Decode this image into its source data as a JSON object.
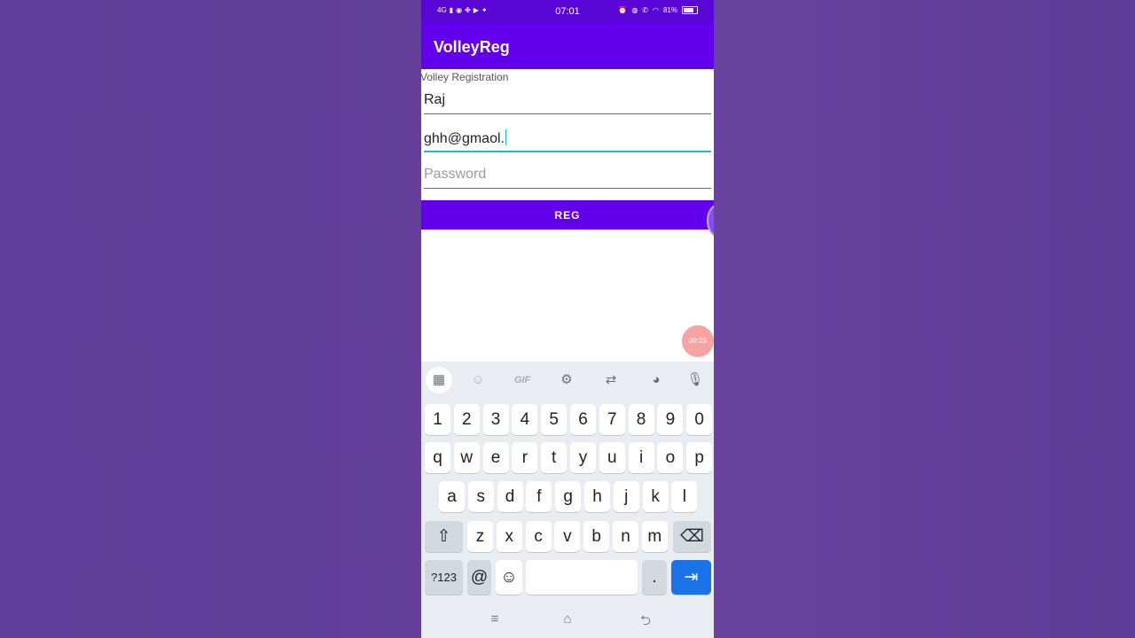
{
  "status_bar": {
    "left_icons": [
      "4G",
      "signal-icon",
      "whatsapp-icon",
      "app-icon",
      "youtube-icon",
      "twitter-icon"
    ],
    "network_label": "4G",
    "time": "07:01",
    "battery": "81%"
  },
  "app_bar": {
    "title": "VolleyReg"
  },
  "form": {
    "label": "Volley Registration",
    "name_value": "Raj",
    "email_value": "ghh@gmaol.",
    "password_placeholder": "Password",
    "reg_button": "REG"
  },
  "overlay": {
    "timer": "00:25"
  },
  "keyboard": {
    "toolbar": [
      "grid-icon",
      "sticker-icon",
      "GIF",
      "gear-icon",
      "translate-icon",
      "palette-icon",
      "mic-off-icon"
    ],
    "gif_label": "GIF",
    "row_numbers": [
      "1",
      "2",
      "3",
      "4",
      "5",
      "6",
      "7",
      "8",
      "9",
      "0"
    ],
    "row_q": [
      "q",
      "w",
      "e",
      "r",
      "t",
      "y",
      "u",
      "i",
      "o",
      "p"
    ],
    "row_a": [
      "a",
      "s",
      "d",
      "f",
      "g",
      "h",
      "j",
      "k",
      "l"
    ],
    "row_z": [
      "z",
      "x",
      "c",
      "v",
      "b",
      "n",
      "m"
    ],
    "sym_key": "?123",
    "at_key": "@",
    "period_key": ".",
    "shift_glyph": "⇧",
    "backspace_glyph": "⌫",
    "emoji_glyph": "☺",
    "enter_glyph": "⇥"
  },
  "nav_bar": {
    "menu_glyph": "≡",
    "home_glyph": "⌂",
    "back_glyph": "⮌"
  }
}
